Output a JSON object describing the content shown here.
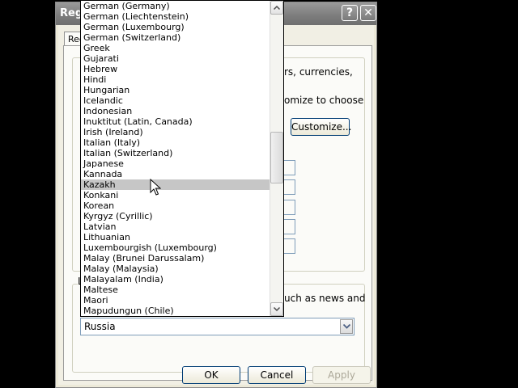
{
  "window": {
    "title": "Regi",
    "help_label": "?",
    "close_label": "✕"
  },
  "tab": {
    "label": "Reg"
  },
  "fragments": {
    "currencies": "rs, currencies,",
    "customize_to_choose": "omize to choose",
    "news_and": "uch as news and",
    "group2_label": "L"
  },
  "buttons": {
    "customize": "Customize...",
    "ok": "OK",
    "cancel": "Cancel",
    "apply": "Apply"
  },
  "combo": {
    "value": "Russia"
  },
  "dropdown": {
    "selected": "Kazakh",
    "items": [
      "German (Germany)",
      "German (Liechtenstein)",
      "German (Luxembourg)",
      "German (Switzerland)",
      "Greek",
      "Gujarati",
      "Hebrew",
      "Hindi",
      "Hungarian",
      "Icelandic",
      "Indonesian",
      "Inuktitut (Latin, Canada)",
      "Irish (Ireland)",
      "Italian (Italy)",
      "Italian (Switzerland)",
      "Japanese",
      "Kannada",
      "Kazakh",
      "Konkani",
      "Korean",
      "Kyrgyz (Cyrillic)",
      "Latvian",
      "Lithuanian",
      "Luxembourgish (Luxembourg)",
      "Malay (Brunei Darussalam)",
      "Malay (Malaysia)",
      "Malayalam (India)",
      "Maltese",
      "Maori",
      "Mapudungun (Chile)"
    ]
  }
}
